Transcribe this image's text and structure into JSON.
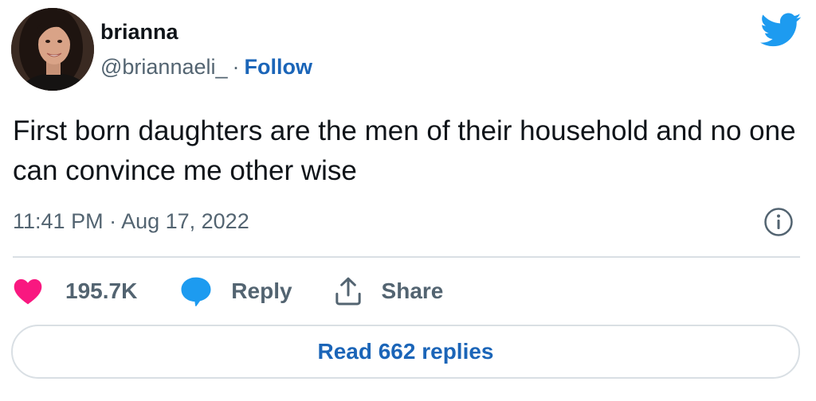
{
  "author": {
    "name": "brianna",
    "handle": "@briannaeli_",
    "separator": "·",
    "follow_label": "Follow"
  },
  "tweet": {
    "text": "First born daughters are the men of their household and no one can convince me other wise",
    "timestamp": "11:41 PM · Aug 17, 2022"
  },
  "actions": {
    "likes": "195.7K",
    "reply_label": "Reply",
    "share_label": "Share"
  },
  "replies_button": {
    "label": "Read 662 replies"
  },
  "icons": {
    "brand": "twitter-bird-icon",
    "info": "info-icon",
    "like": "heart-icon",
    "reply": "speech-bubble-icon",
    "share": "share-upload-icon"
  },
  "colors": {
    "brand_blue": "#1d9bf0",
    "link_blue": "#1b65b8",
    "like_pink": "#f91880",
    "text_primary": "#0f1419",
    "text_secondary": "#536471",
    "divider": "#d9dfe4"
  }
}
